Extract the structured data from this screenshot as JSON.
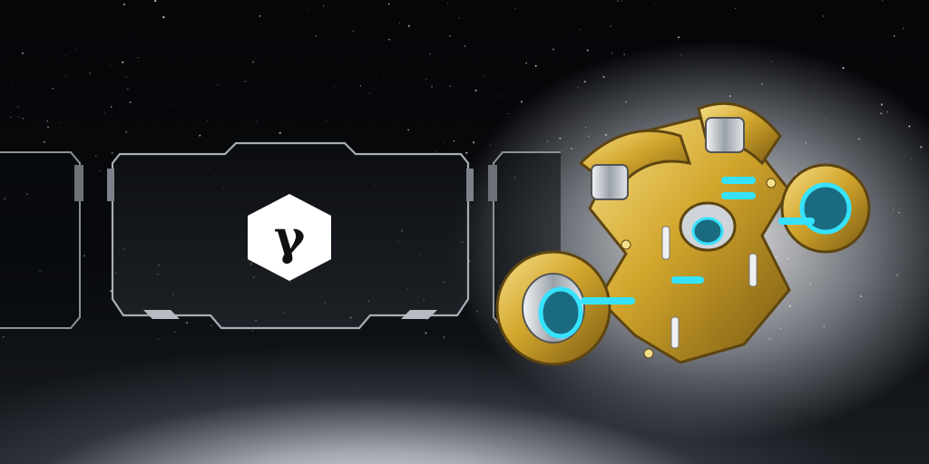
{
  "scene": {
    "icon": "relic-artifact-icon",
    "badge_glyph": "γ",
    "colors": {
      "background": "#050608",
      "card_border": "#9aa0a8",
      "gold": "#d9b23a",
      "cyan_glow": "#35e3ff",
      "silver": "#cfd4da",
      "badge_fill": "#ffffff"
    }
  }
}
